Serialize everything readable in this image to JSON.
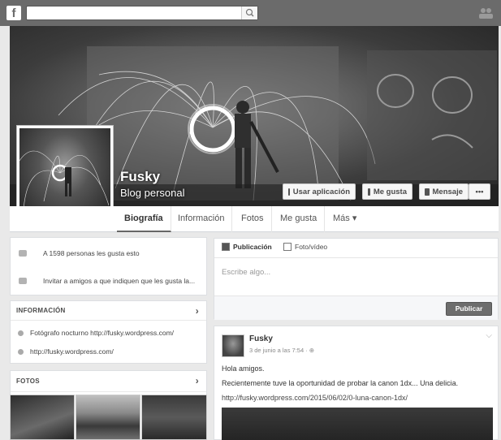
{
  "topbar": {
    "logo": "f",
    "search_placeholder": "",
    "search_icon": "search-icon",
    "friends_icon": "friend-requests-icon"
  },
  "page": {
    "name": "Fusky",
    "category": "Blog personal"
  },
  "cover_buttons": {
    "use_app": "Usar aplicación",
    "like": "Me gusta",
    "message": "Mensaje",
    "more": "•••"
  },
  "nav_tabs": [
    "Biografía",
    "Información",
    "Fotos",
    "Me gusta",
    "Más ▾"
  ],
  "left": {
    "likes_text": "A 1598 personas les gusta esto",
    "invite_text": "Invitar a amigos a que indiquen que les gusta la...",
    "info_header": "INFORMACIÓN",
    "info_items": [
      "Fotógrafo nocturno http://fusky.wordpress.com/",
      "http://fusky.wordpress.com/"
    ],
    "photos_header": "FOTOS"
  },
  "composer": {
    "tab_post": "Publicación",
    "tab_photo": "Foto/vídeo",
    "placeholder": "Escribe algo...",
    "publish": "Publicar"
  },
  "post": {
    "author": "Fusky",
    "time": "3 de junio a las 7:54 · ⊕",
    "line1": "Hola amigos.",
    "line2": "Recientemente tuve la oportunidad de probar la canon 1dx... Una delicia.",
    "link": "http://fusky.wordpress.com/2015/06/02/0-luna-canon-1dx/"
  },
  "colors": {
    "topbar": "#6b6b6b",
    "publish_button": "#6d6d6d"
  }
}
